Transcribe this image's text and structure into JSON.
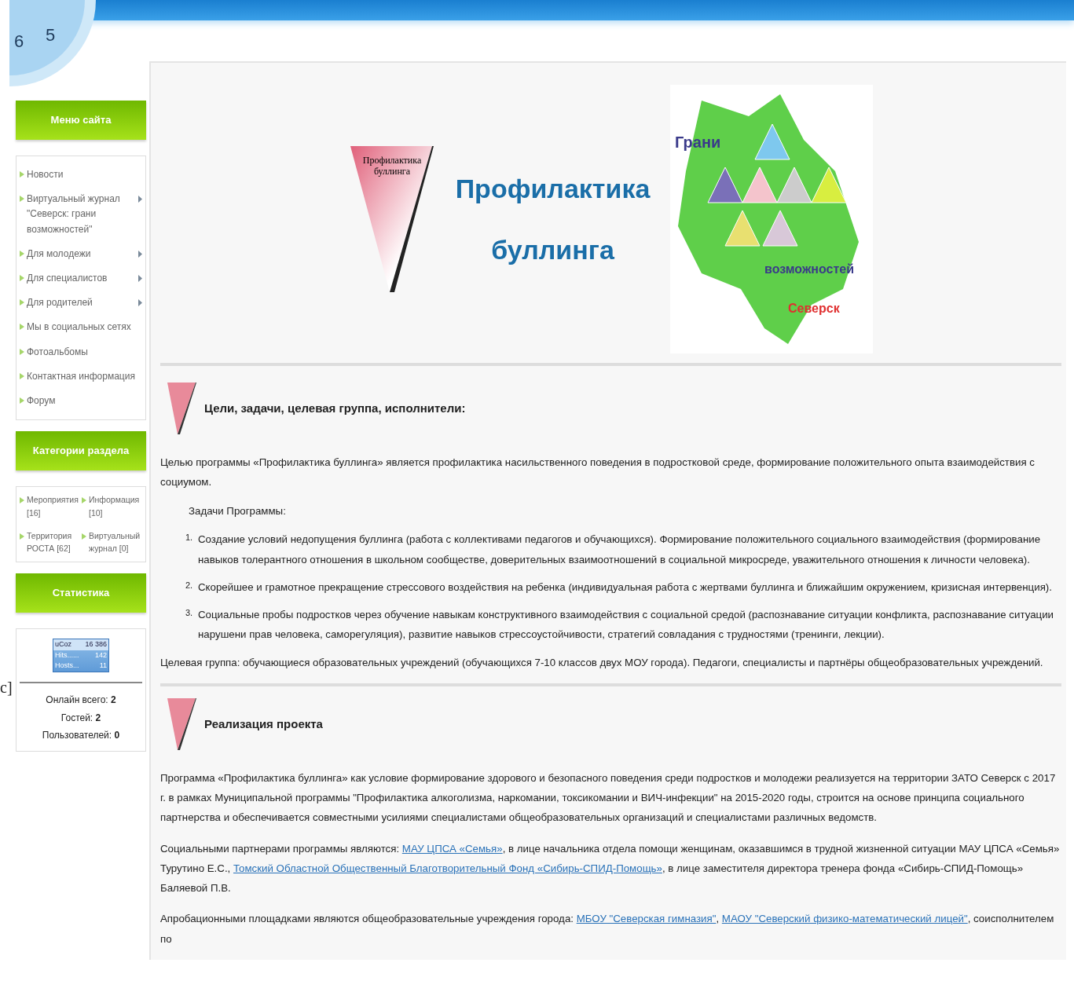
{
  "header": {
    "clock_numerals": [
      "6",
      "5"
    ]
  },
  "edge_fragment": "с]",
  "sidebar": {
    "blocks": [
      {
        "kind": "menu",
        "title": "Меню сайта",
        "items": [
          {
            "label": "Новости",
            "has_submenu": false
          },
          {
            "label": "Виртуальный журнал \"Северск: грани возможностей\"",
            "has_submenu": true
          },
          {
            "label": "Для молодежи",
            "has_submenu": true
          },
          {
            "label": "Для специалистов",
            "has_submenu": true
          },
          {
            "label": "Для родителей",
            "has_submenu": true
          },
          {
            "label": "Мы в социальных сетях",
            "has_submenu": false
          },
          {
            "label": "Фотоальбомы",
            "has_submenu": false
          },
          {
            "label": "Контактная информация",
            "has_submenu": false
          },
          {
            "label": "Форум",
            "has_submenu": false
          }
        ]
      },
      {
        "kind": "categories",
        "title": "Категории раздела",
        "items": [
          {
            "label": "Мероприятия [16]"
          },
          {
            "label": "Информация [10]"
          },
          {
            "label": "Территория РОСТА [62]"
          },
          {
            "label": "Виртуальный журнал [0]"
          }
        ]
      },
      {
        "kind": "stats",
        "title": "Статистика",
        "counter": {
          "logo": "uCoz",
          "total": "16 386",
          "rows": [
            {
              "label": "Hits......",
              "value": "142"
            },
            {
              "label": "Hosts...",
              "value": "11"
            }
          ]
        },
        "lines": [
          "Онлайн всего: **2**",
          "Гостей: **2**",
          "Пользователей: **0**"
        ]
      }
    ]
  },
  "banner": {
    "logo_text": "Профилактика буллинга",
    "title_lines": [
      "Профилактика",
      "буллинга"
    ],
    "map_labels": [
      "Грани",
      "возможностей",
      "Северск"
    ]
  },
  "sections": [
    {
      "heading": "Цели, задачи, целевая группа, исполнители:",
      "blocks": [
        {
          "kind": "para",
          "segments": [
            {
              "text": "Целью программы «Профилактика буллинга» является профилактика насильственного поведения в подростковой среде, формирование положительного опыта взаимодействия с социумом."
            }
          ]
        },
        {
          "kind": "subhead",
          "text": "Задачи Программы:"
        },
        {
          "kind": "list",
          "items": [
            {
              "number": "1.",
              "text": "Создание условий недопущения буллинга (работа с коллективами педагогов и обучающихся). Формирование положительного социального взаимодействия (формирование навыков толерантного отношения в школьном сообществе, доверительных взаимоотношений в социальной микросреде, уважительного отношения к личности человека)."
            },
            {
              "number": "2.",
              "text": "Скорейшее и грамотное прекращение стрессового воздействия на ребенка (индивидуальная работа с жертвами буллинга и ближайшим окружением, кризисная интервенция)."
            },
            {
              "number": "3.",
              "text": "Социальные пробы подростков через обучение навыкам конструктивного взаимодействия с социальной средой (распознавание ситуации конфликта, распознавание ситуации нарушени прав человека, саморегуляция), развитие навыков стрессоустойчивости, стратегий совладания с трудностями (тренинги, лекции)."
            }
          ]
        },
        {
          "kind": "para",
          "segments": [
            {
              "text": "Целевая группа: обучающиеся образовательных учреждений (обучающихся 7-10 классов двух МОУ города). Педагоги, специалисты и партнёры общеобразовательных учреждений."
            }
          ]
        }
      ]
    },
    {
      "heading": "Реализация проекта",
      "blocks": [
        {
          "kind": "para",
          "segments": [
            {
              "text": "Программа «Профилактика буллинга» как условие формирование здорового и безопасного поведения среди подростков и молодежи реализуется на территории ЗАТО Северск с 2017 г. в рамках Муниципальной программы \"Профилактика алкоголизма, наркомании, токсикомании и ВИЧ-инфекции\" на 2015-2020 годы, строится на основе принципа социального партнерства и обеспечивается совместными усилиями специалистами общеобразовательных организаций и специалистами различных ведомств."
            }
          ]
        },
        {
          "kind": "para",
          "segments": [
            {
              "text": "Социальными партнерами программы являются: "
            },
            {
              "link": "МАУ ЦПСА «Семья»"
            },
            {
              "text": ", в лице начальника отдела помощи женщинам, оказавшимся в трудной жизненной ситуации МАУ ЦПСА «Семья» Турутино Е.С., "
            },
            {
              "link": "Томский Областной Общественный Благотворительный Фонд «Сибирь-СПИД-Помощь»"
            },
            {
              "text": ", в лице заместителя директора тренера фонда «Сибирь-СПИД-Помощь» Баляевой П.В."
            }
          ]
        },
        {
          "kind": "para",
          "segments": [
            {
              "text": "Апробационными площадками являются общеобразовательные учреждения города: "
            },
            {
              "link": "МБОУ \"Северская гимназия\""
            },
            {
              "text": ", "
            },
            {
              "link": "МАОУ \"Северский физико-математический лицей\""
            },
            {
              "text": ", соисполнителем по"
            }
          ]
        }
      ]
    }
  ]
}
